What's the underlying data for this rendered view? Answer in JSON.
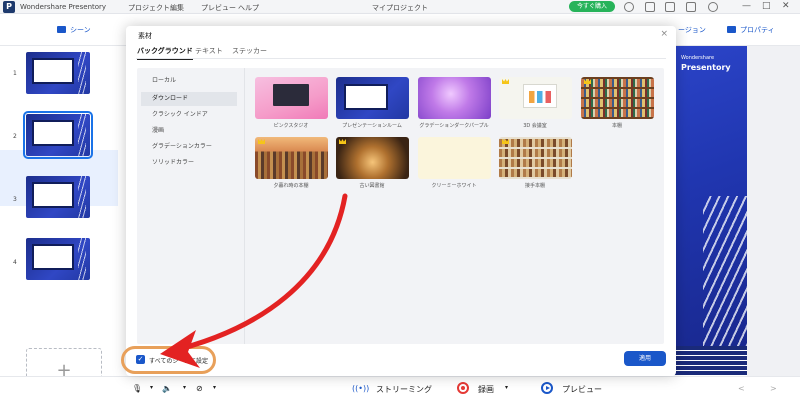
{
  "titlebar": {
    "logo_glyph": "P",
    "app_name": "Wondershare Presentory",
    "menu": [
      "プロジェクト",
      "編集",
      "プレビュー",
      "ヘルプ"
    ],
    "project_title": "マイプロジェクト",
    "buy_label": "今すぐ購入",
    "window_controls": [
      "—",
      "□",
      "✕"
    ]
  },
  "toolbar": {
    "left_label": "シーン",
    "right_labels": [
      "ージョン",
      "プロパティ"
    ]
  },
  "slides": {
    "numbers": [
      "1",
      "2",
      "3",
      "4"
    ],
    "selected_index": 2,
    "add_label": "+"
  },
  "canvas": {
    "logo_small": "Wondershare",
    "logo_big": "Presentory"
  },
  "dialog": {
    "title": "素材",
    "close": "×",
    "tabs": [
      "バックグラウンド",
      "テキスト",
      "ステッカー"
    ],
    "active_tab": "バックグラウンド",
    "categories": [
      "ローカル",
      "ダウンロード",
      "クラシック インドア",
      "漫画",
      "グラデーションカラー",
      "ソリッドカラー"
    ],
    "active_category": "ダウンロード",
    "thumbnails": [
      {
        "label": "ピンクスタジオ",
        "premium": false,
        "style": "pink"
      },
      {
        "label": "プレゼンテーションルーム",
        "premium": false,
        "style": "blue"
      },
      {
        "label": "グラデーションダークパープル",
        "premium": false,
        "style": "purple"
      },
      {
        "label": "3D 会議室",
        "premium": true,
        "style": "white3d"
      },
      {
        "label": "本棚",
        "premium": true,
        "style": "shelf"
      },
      {
        "label": "夕暮れ時の本棚",
        "premium": true,
        "style": "sunset"
      },
      {
        "label": "古い図書館",
        "premium": true,
        "style": "library"
      },
      {
        "label": "クリーミーホワイト",
        "premium": false,
        "style": "cream"
      },
      {
        "label": "接手本棚",
        "premium": true,
        "style": "light"
      }
    ],
    "apply_all_label": "すべてのシーンに設定",
    "apply_all_checked": true,
    "apply_label": "適用"
  },
  "bottombar": {
    "streaming_label": "ストリーミング",
    "record_label": "録画",
    "preview_label": "プレビュー",
    "nav": [
      "<",
      ">"
    ]
  },
  "colors": {
    "accent": "#1a57c9",
    "buy_green": "#27b35a",
    "record_red": "#e53935",
    "arrow_red": "#e32222",
    "highlight_ring": "#e8a05a"
  }
}
